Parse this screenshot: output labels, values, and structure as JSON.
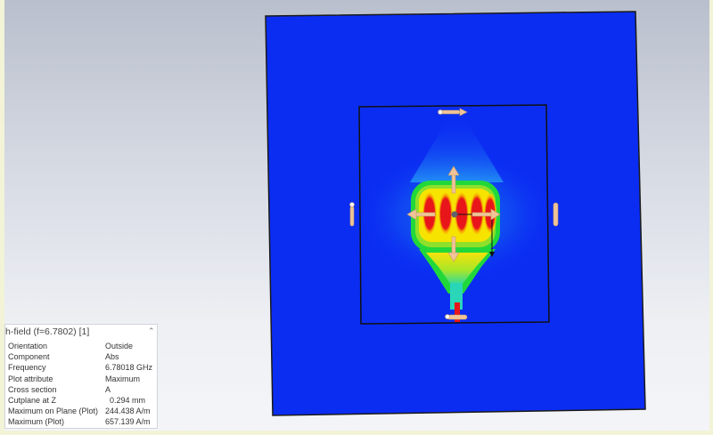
{
  "info_panel": {
    "title": "h-field (f=6.7802) [1]",
    "toggle_icon": "chevron-up-icon",
    "rows": [
      {
        "key": "Orientation",
        "value": "Outside"
      },
      {
        "key": "Component",
        "value": "Abs"
      },
      {
        "key": "Frequency",
        "value": "6.78018 GHz"
      },
      {
        "key": "Plot attribute",
        "value": "Maximum"
      },
      {
        "key": "Cross section",
        "value": "A"
      },
      {
        "key": "Cutplane at Z",
        "value": "  0.294 mm"
      },
      {
        "key": "Maximum on Plane (Plot)",
        "value": "244.438 A/m"
      },
      {
        "key": "Maximum (Plot)",
        "value": "657.139 A/m"
      }
    ]
  },
  "colors": {
    "field_background": "#0b2df2",
    "field_max": "#e8151a",
    "field_high": "#f7e300",
    "field_mid": "#21d83b",
    "field_low": "#1aa8f0",
    "arrow": "#f0c498"
  }
}
